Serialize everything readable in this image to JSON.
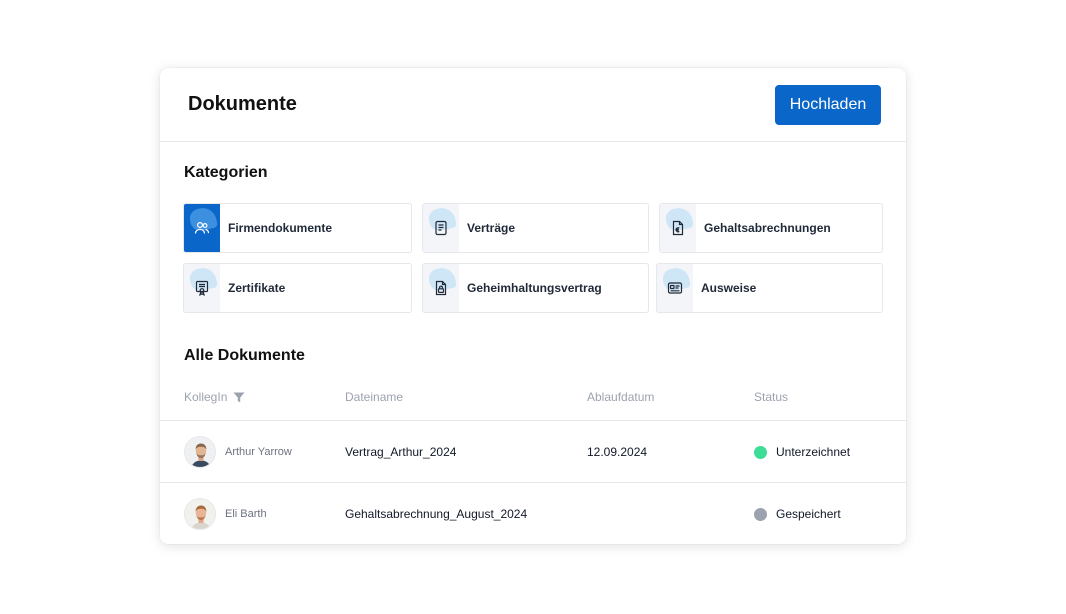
{
  "header": {
    "title": "Dokumente",
    "upload_label": "Hochladen"
  },
  "categories": {
    "title": "Kategorien",
    "items": [
      {
        "label": "Firmendokumente",
        "icon": "people-icon",
        "active": true
      },
      {
        "label": "Verträge",
        "icon": "document-icon",
        "active": false
      },
      {
        "label": "Gehaltsabrechnungen",
        "icon": "payslip-icon",
        "active": false
      },
      {
        "label": "Zertifikate",
        "icon": "certificate-icon",
        "active": false
      },
      {
        "label": "Geheimhaltungsvertrag",
        "icon": "lock-document-icon",
        "active": false
      },
      {
        "label": "Ausweise",
        "icon": "id-card-icon",
        "active": false
      }
    ]
  },
  "documents": {
    "title": "Alle Dokumente",
    "columns": {
      "colleague": "KollegIn",
      "filename": "Dateiname",
      "expiry": "Ablaufdatum",
      "status": "Status"
    },
    "rows": [
      {
        "colleague": "Arthur Yarrow",
        "filename": "Vertrag_Arthur_2024",
        "expiry": "12.09.2024",
        "status": "Unterzeichnet",
        "status_color": "#3ddc97"
      },
      {
        "colleague": "Eli Barth",
        "filename": "Gehaltsabrechnung_August_2024",
        "expiry": "",
        "status": "Gespeichert",
        "status_color": "#9ca3af"
      }
    ]
  },
  "colors": {
    "accent": "#0a66c8"
  }
}
